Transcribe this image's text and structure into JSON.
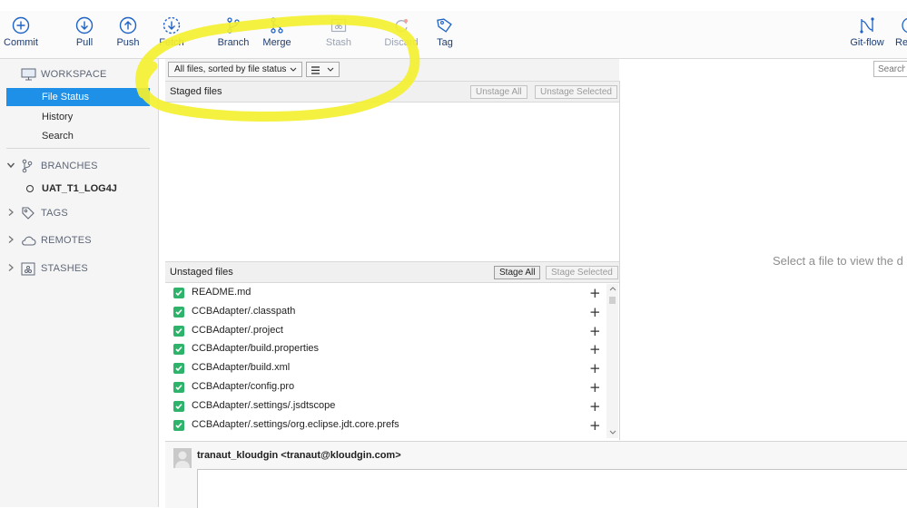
{
  "toolbar": {
    "items": [
      {
        "label": "Commit",
        "icon": "plus-circle-icon"
      },
      {
        "label": "Pull",
        "icon": "arrow-down-circle-icon"
      },
      {
        "label": "Push",
        "icon": "arrow-up-circle-icon"
      },
      {
        "label": "Fetch",
        "icon": "fetch-dashed-circle-icon"
      },
      {
        "label": "Branch",
        "icon": "branch-icon"
      },
      {
        "label": "Merge",
        "icon": "merge-icon"
      },
      {
        "label": "Stash",
        "icon": "stash-icon"
      },
      {
        "label": "Discard",
        "icon": "discard-icon"
      },
      {
        "label": "Tag",
        "icon": "tag-icon"
      },
      {
        "label": "Git-flow",
        "icon": "git-flow-icon"
      },
      {
        "label": "Re",
        "icon": "remote-icon"
      }
    ]
  },
  "sidebar": {
    "workspace": {
      "label": "WORKSPACE",
      "icon": "monitor-icon"
    },
    "workspace_items": [
      "File Status",
      "History",
      "Search"
    ],
    "branches": {
      "label": "BRANCHES",
      "icon": "branch-icon"
    },
    "current_branch": "UAT_T1_LOG4J",
    "tags": {
      "label": "TAGS",
      "icon": "tag-icon"
    },
    "remotes": {
      "label": "REMOTES",
      "icon": "cloud-icon"
    },
    "stashes": {
      "label": "STASHES",
      "icon": "stashes-icon"
    }
  },
  "filter": {
    "sort_dropdown": "All files, sorted by file status",
    "view_dropdown_icon": "list-icon"
  },
  "search": {
    "placeholder": "Search"
  },
  "staged": {
    "title": "Staged files",
    "unstage_all": "Unstage All",
    "unstage_selected": "Unstage Selected"
  },
  "unstaged": {
    "title": "Unstaged files",
    "stage_all": "Stage All",
    "stage_selected": "Stage Selected",
    "files": [
      "README.md",
      "CCBAdapter/.classpath",
      "CCBAdapter/.project",
      "CCBAdapter/build.properties",
      "CCBAdapter/build.xml",
      "CCBAdapter/config.pro",
      "CCBAdapter/.settings/.jsdtscope",
      "CCBAdapter/.settings/org.eclipse.jdt.core.prefs"
    ]
  },
  "diff": {
    "hint": "Select a file to view the d"
  },
  "commit": {
    "author": "tranaut_kloudgin <tranaut@kloudgin.com>"
  },
  "colors": {
    "accent": "#1e90e8",
    "toolbar_label": "#1e3d73",
    "check": "#2eb36a",
    "highlight": "#f4f030"
  }
}
